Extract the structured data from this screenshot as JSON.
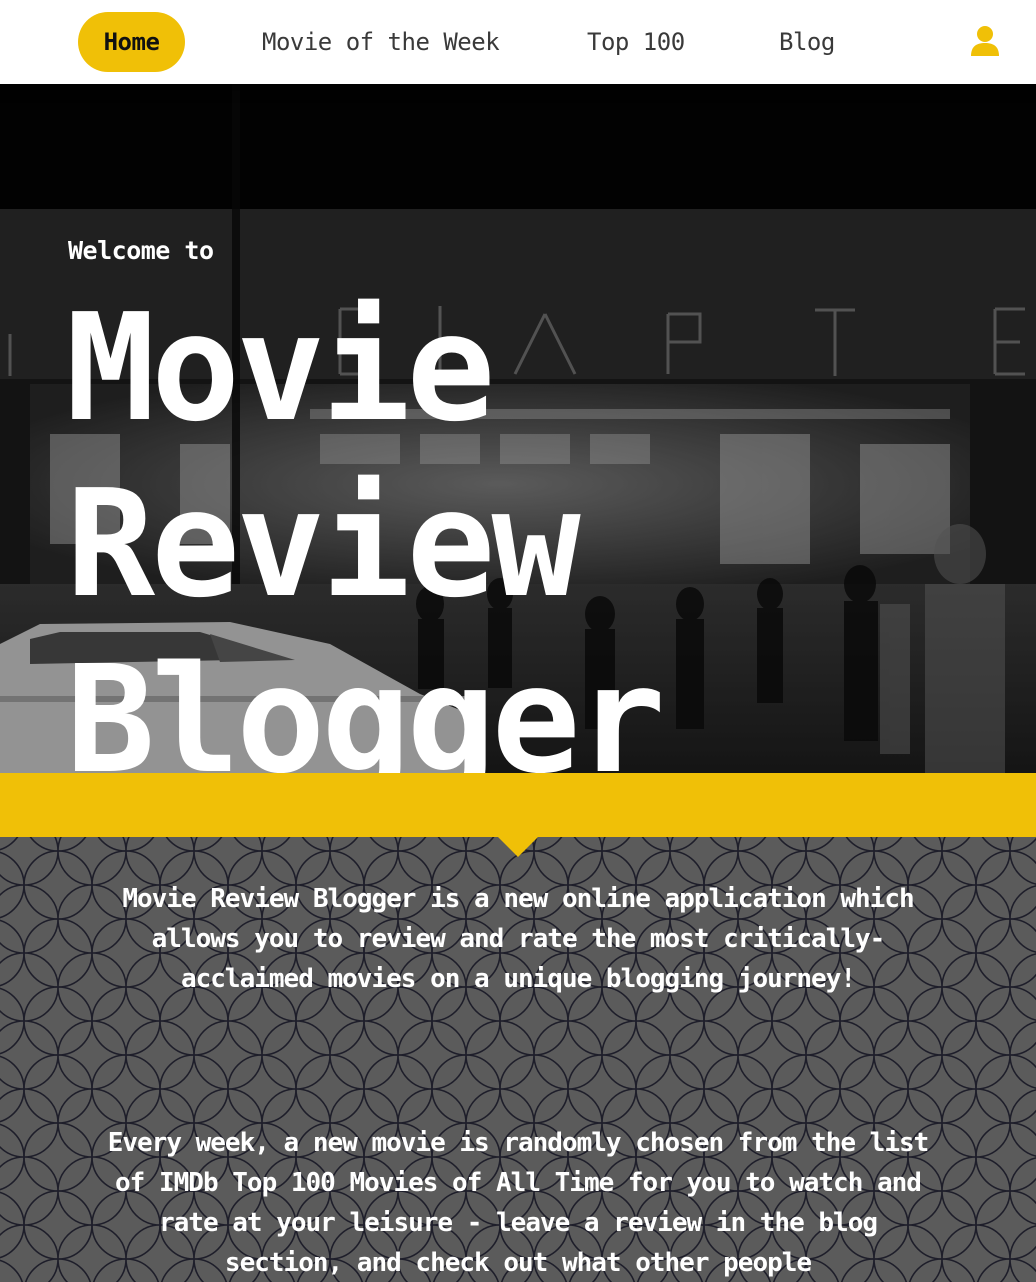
{
  "nav": {
    "items": [
      {
        "label": "Home",
        "active": true
      },
      {
        "label": "Movie of the Week",
        "active": false
      },
      {
        "label": "Top 100",
        "active": false
      },
      {
        "label": "Blog",
        "active": false
      }
    ],
    "user_icon": "user-icon"
  },
  "hero": {
    "welcome": "Welcome to",
    "title": "Movie Review Blogger"
  },
  "intro": {
    "paragraph1": "Movie Review Blogger is a new online application which allows you to review and rate the most critically-acclaimed movies on a unique blogging journey!",
    "paragraph2": "Every week, a new movie is randomly chosen from the list of IMDb Top 100 Movies of All Time for you to watch and rate at your leisure - leave a review in the blog section, and check out what other people"
  },
  "colors": {
    "accent": "#f0c007",
    "nav_bg": "#ffffff",
    "section_bg": "#5b5b5b"
  }
}
